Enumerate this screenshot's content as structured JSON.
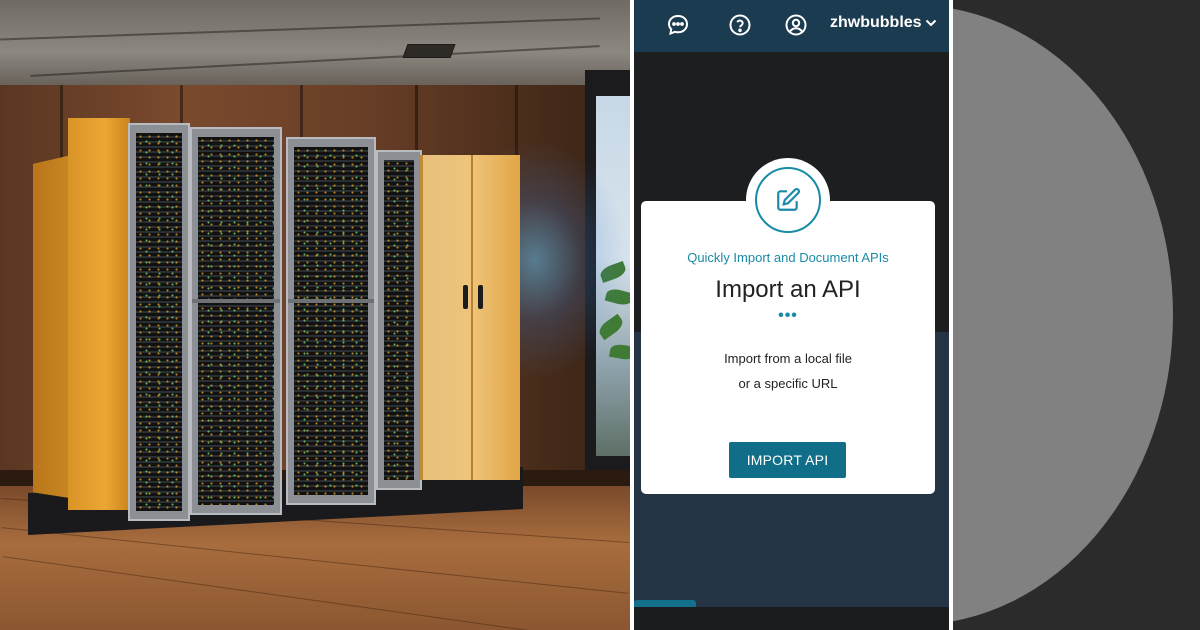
{
  "header": {
    "username": "zhwbubbles",
    "icons": [
      "chat-icon",
      "help-icon",
      "account-icon",
      "chevron-down-icon"
    ]
  },
  "card": {
    "subtitle": "Quickly Import and Document APIs",
    "title": "Import an API",
    "dots": "•••",
    "desc_line1": "Import from a local file",
    "desc_line2": "or a specific URL",
    "button_label": "IMPORT API",
    "badge_icon": "edit-icon"
  },
  "colors": {
    "header_bg": "#1b3b50",
    "accent": "#1a8aa6",
    "button_bg": "#106e88",
    "cabinet_yellow": "#eda634"
  }
}
